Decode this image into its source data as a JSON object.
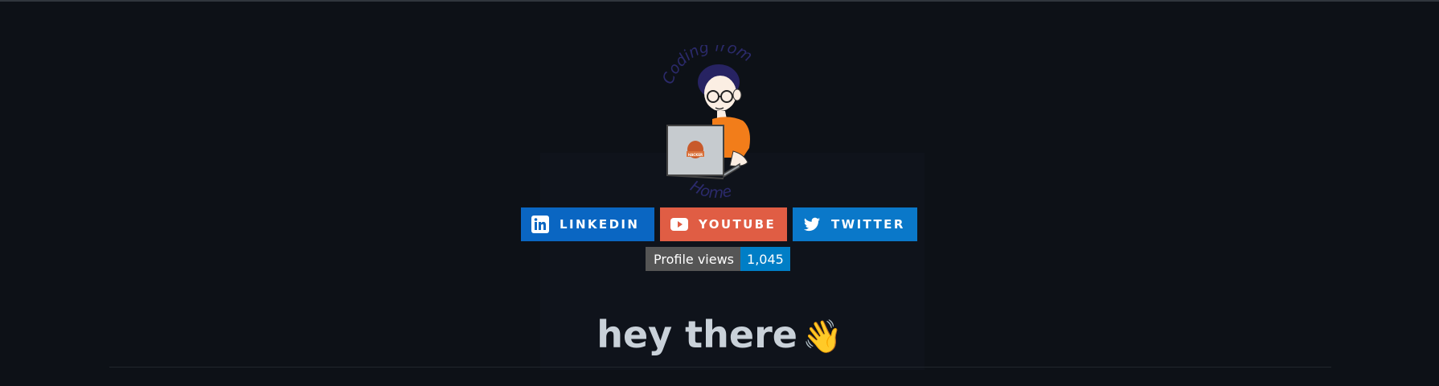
{
  "avatar": {
    "caption_top": "Coding from",
    "caption_bottom": "Home",
    "laptop_sticker": "HACKER"
  },
  "social": {
    "linkedin": {
      "label": "LINKEDIN",
      "icon": "linkedin-icon",
      "color": "#0a66c2"
    },
    "youtube": {
      "label": "YOUTUBE",
      "icon": "youtube-icon",
      "color": "#e05d44"
    },
    "twitter": {
      "label": "TWITTER",
      "icon": "twitter-icon",
      "color": "#0a78c9"
    }
  },
  "profile_views": {
    "label": "Profile views",
    "count": "1,045",
    "label_color": "#555555",
    "count_color": "#007ec6"
  },
  "heading": {
    "text": "hey there",
    "emoji": "👋"
  }
}
